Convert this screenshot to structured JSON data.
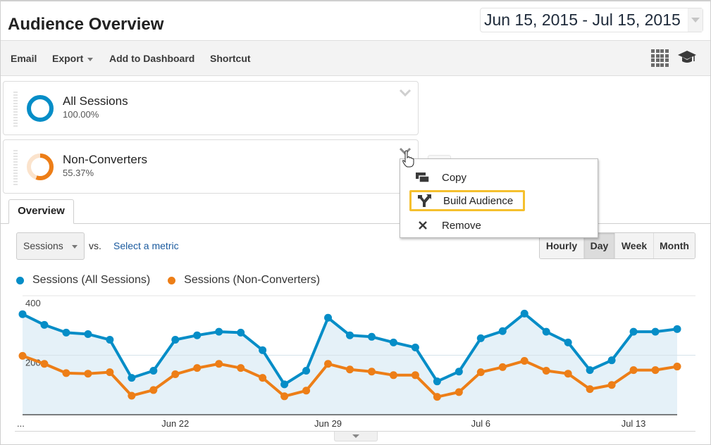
{
  "header": {
    "title": "Audience Overview",
    "date_range": "Jun 15, 2015 - Jul 15, 2015"
  },
  "toolbar": {
    "email": "Email",
    "export": "Export",
    "add_to_dashboard": "Add to Dashboard",
    "shortcut": "Shortcut",
    "icons": [
      "grid-icon",
      "graduation-cap-icon"
    ]
  },
  "segments": [
    {
      "name": "All Sessions",
      "percent": "100.00%",
      "fraction": 1.0,
      "color": "#058dc7"
    },
    {
      "name": "Non-Converters",
      "percent": "55.37%",
      "fraction": 0.5537,
      "color": "#ed7e17"
    }
  ],
  "segment_menu": {
    "items": [
      {
        "label": "Copy",
        "icon": "copy-icon"
      },
      {
        "label": "Build Audience",
        "icon": "build-audience-icon",
        "highlighted": true
      },
      {
        "label": "Remove",
        "icon": "close-icon"
      }
    ]
  },
  "tabs": [
    {
      "label": "Overview",
      "active": true
    }
  ],
  "controls": {
    "metric": "Sessions",
    "vs_label": "vs.",
    "select_metric": "Select a metric",
    "granularity": [
      {
        "label": "Hourly",
        "active": false
      },
      {
        "label": "Day",
        "active": true
      },
      {
        "label": "Week",
        "active": false
      },
      {
        "label": "Month",
        "active": false
      }
    ]
  },
  "chart_data": {
    "type": "line",
    "title": "",
    "xlabel": "",
    "ylabel": "",
    "ylim": [
      0,
      400
    ],
    "yticks": [
      200,
      400
    ],
    "grid": true,
    "legend_position": "top-left",
    "x_tick_labels": [
      "...",
      "Jun 22",
      "Jun 29",
      "Jul 6",
      "Jul 13"
    ],
    "x_tick_indices": [
      0,
      7,
      14,
      21,
      28
    ],
    "x": [
      "Jun 15",
      "Jun 16",
      "Jun 17",
      "Jun 18",
      "Jun 19",
      "Jun 20",
      "Jun 21",
      "Jun 22",
      "Jun 23",
      "Jun 24",
      "Jun 25",
      "Jun 26",
      "Jun 27",
      "Jun 28",
      "Jun 29",
      "Jun 30",
      "Jul 1",
      "Jul 2",
      "Jul 3",
      "Jul 4",
      "Jul 5",
      "Jul 6",
      "Jul 7",
      "Jul 8",
      "Jul 9",
      "Jul 10",
      "Jul 11",
      "Jul 12",
      "Jul 13",
      "Jul 14",
      "Jul 15"
    ],
    "series": [
      {
        "name": "Sessions (All Sessions)",
        "color": "#058dc7",
        "area": true,
        "values": [
          338,
          302,
          276,
          271,
          252,
          124,
          148,
          252,
          267,
          279,
          276,
          217,
          102,
          148,
          326,
          267,
          262,
          243,
          226,
          112,
          145,
          257,
          281,
          340,
          279,
          243,
          150,
          183,
          279,
          279,
          288
        ]
      },
      {
        "name": "Sessions (Non-Converters)",
        "color": "#ed7e17",
        "area": false,
        "values": [
          198,
          171,
          140,
          138,
          143,
          64,
          83,
          136,
          157,
          171,
          157,
          124,
          62,
          81,
          171,
          152,
          145,
          133,
          133,
          60,
          76,
          143,
          160,
          181,
          148,
          138,
          86,
          100,
          150,
          150,
          162
        ]
      }
    ]
  }
}
